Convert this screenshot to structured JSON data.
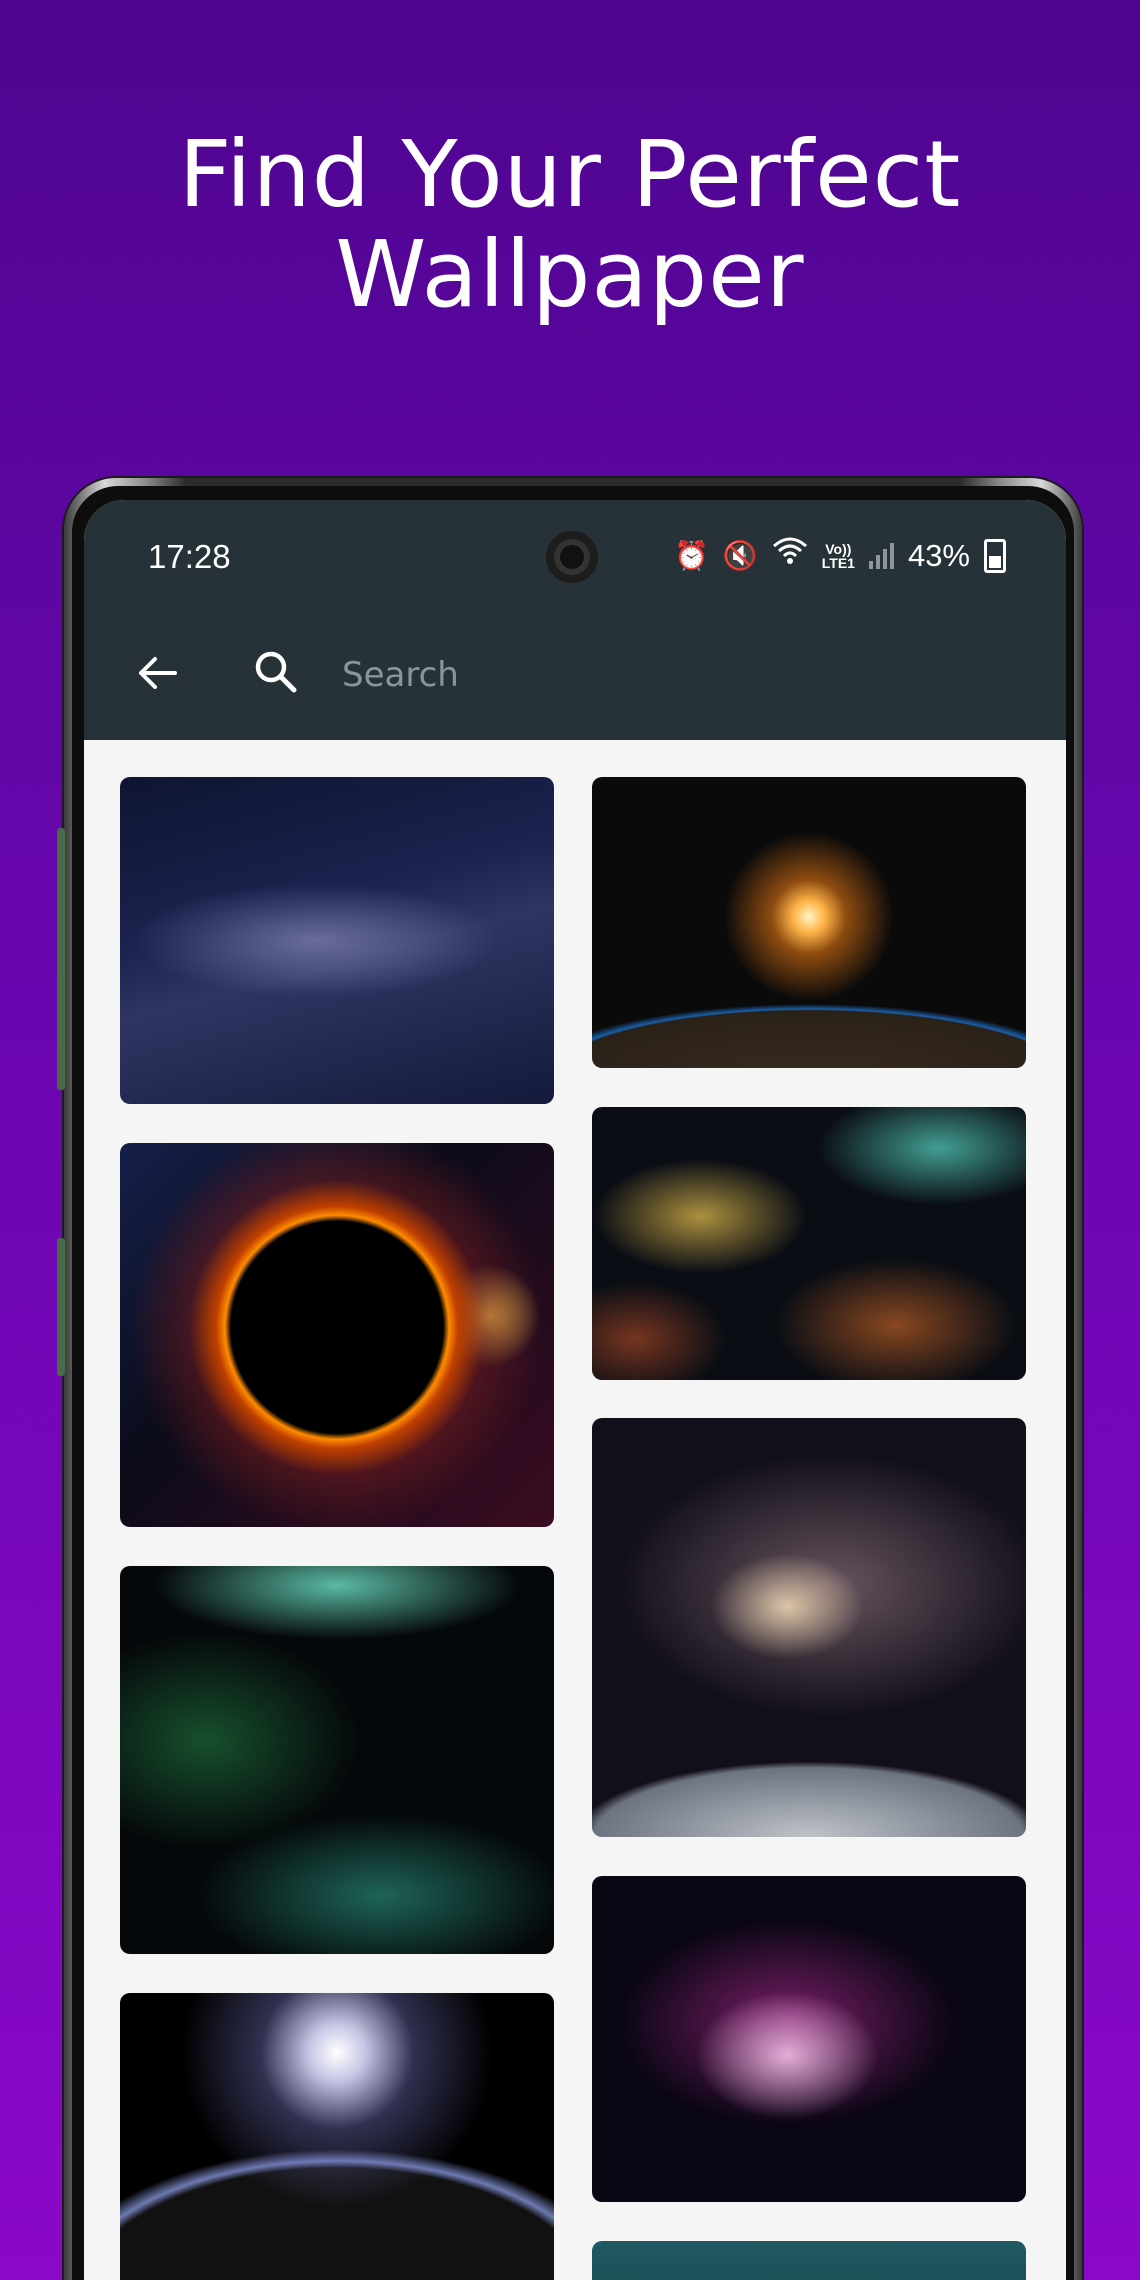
{
  "promo": {
    "title_line1": "Find Your Perfect",
    "title_line2": "Wallpaper"
  },
  "status_bar": {
    "time": "17:28",
    "volte": "Vo))",
    "lte": "LTE1",
    "battery": "43%"
  },
  "toolbar": {
    "search_placeholder": "Search"
  },
  "icons": [
    "arrow-left-icon",
    "search-icon",
    "alarm-icon",
    "mute-icon",
    "wifi-icon",
    "signal-icon",
    "battery-icon"
  ],
  "colors": {
    "background_top": "#4e0590",
    "background_bottom": "#8a08c8",
    "appbar": "#263238",
    "screen_bg": "#f5f5f5"
  },
  "wallpapers": [
    {
      "subject": "milky-way"
    },
    {
      "subject": "sunrise-over-earth"
    },
    {
      "subject": "solar-eclipse"
    },
    {
      "subject": "colorful-nebula"
    },
    {
      "subject": "galaxy-over-planet"
    },
    {
      "subject": "green-nebula"
    },
    {
      "subject": "purple-nebula"
    },
    {
      "subject": "planet-eclipse"
    },
    {
      "subject": "teal-space"
    }
  ]
}
